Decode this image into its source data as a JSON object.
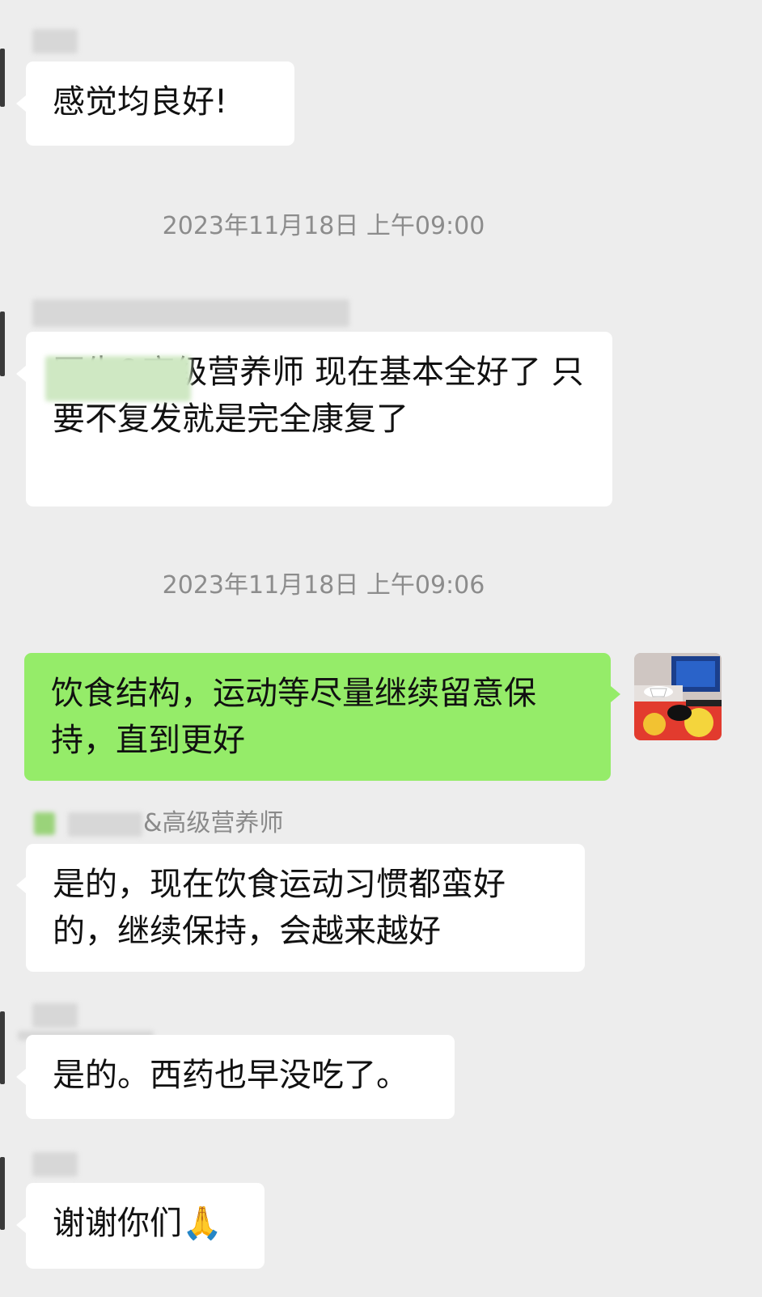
{
  "messages": [
    {
      "text": "感觉均良好!"
    },
    {
      "timestamp": "2023年11月18日 上午09:00"
    },
    {
      "text": "医生&高级营养师 现在基本全好了 只要不复发就是完全康复了"
    },
    {
      "timestamp": "2023年11月18日 上午09:06"
    },
    {
      "text": "饮食结构，运动等尽量继续留意保持，直到更好"
    },
    {
      "sender_visible": "&高级营养师",
      "text": "是的，现在饮食运动习惯都蛮好的，继续保持，会越来越好"
    },
    {
      "text": "是的。西药也早没吃了。"
    },
    {
      "text": "谢谢你们",
      "emoji": "🙏"
    }
  ],
  "colors": {
    "background": "#ededed",
    "incoming_bubble": "#ffffff",
    "outgoing_bubble": "#95ec69",
    "timestamp_text": "#8c8c8c"
  },
  "icons": {
    "prayer": "folded-hands-emoji"
  }
}
